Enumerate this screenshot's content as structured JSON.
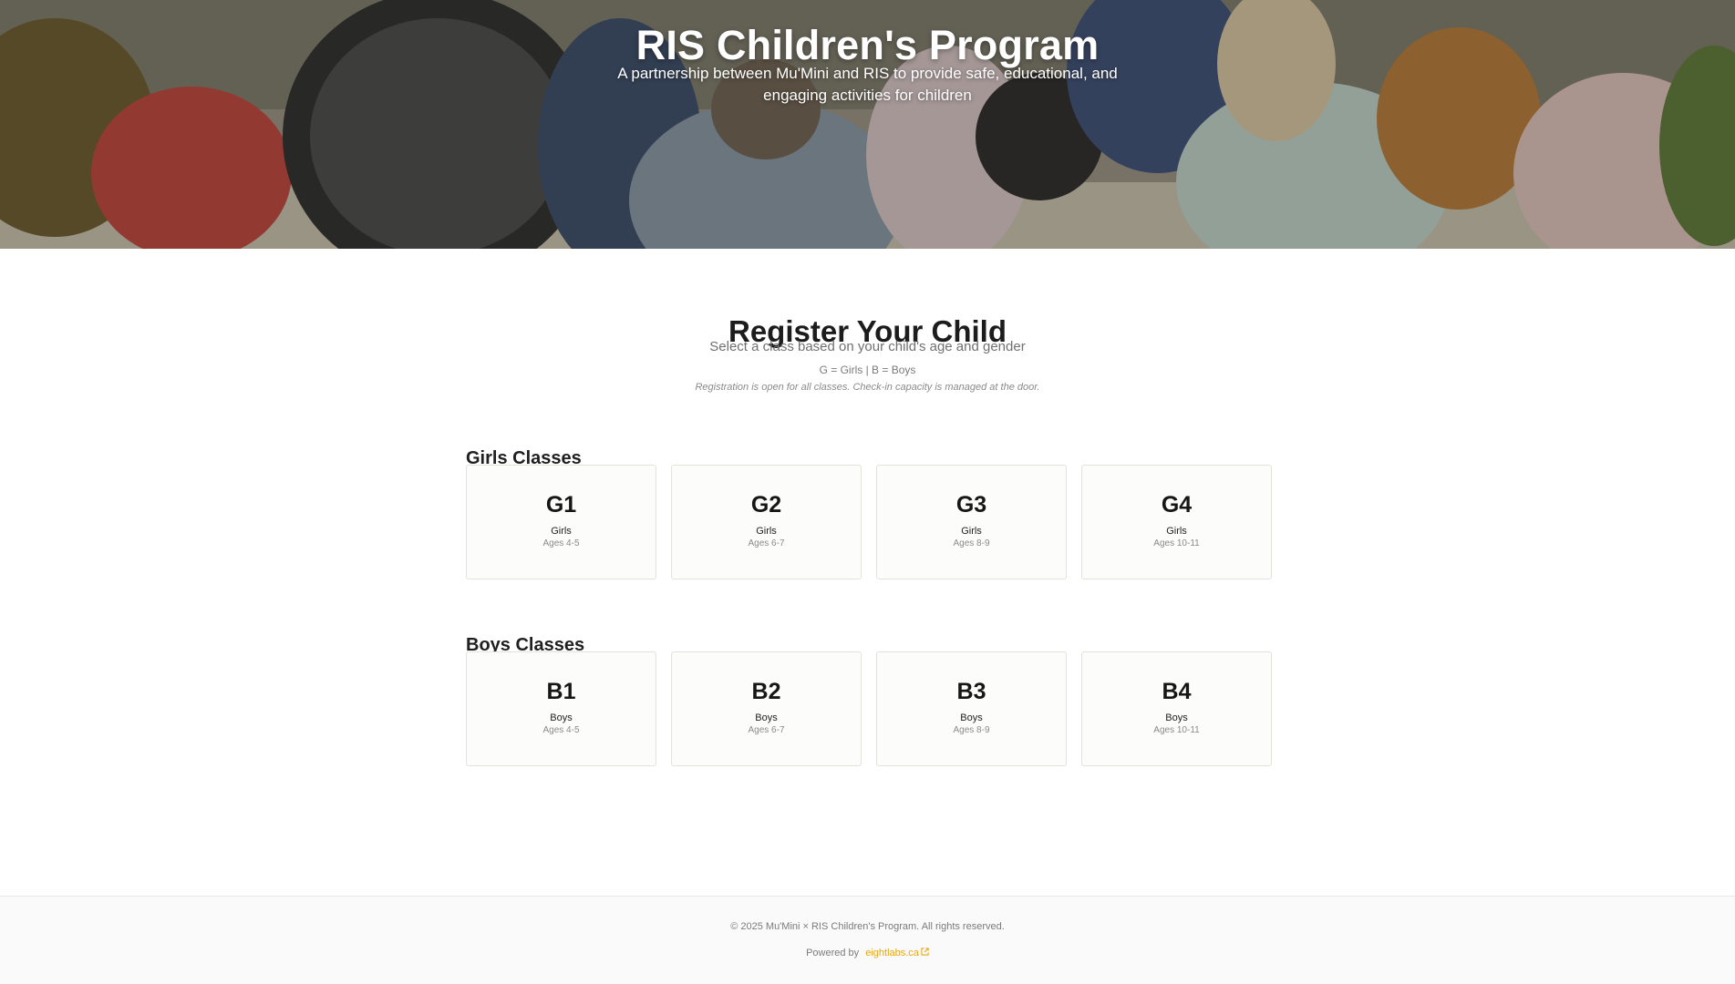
{
  "hero": {
    "title": "RIS Children's Program",
    "subtitle": "A partnership between Mu'Mini and RIS to provide safe, educational, and engaging activities for children"
  },
  "register": {
    "heading": "Register Your Child",
    "subheading": "Select a class based on your child's age and gender",
    "legend": "G = Girls | B = Boys",
    "note": "Registration is open for all classes. Check-in capacity is managed at the door."
  },
  "girls": {
    "heading": "Girls Classes",
    "classes": [
      {
        "code": "G1",
        "gender": "Girls",
        "ages": "Ages 4-5"
      },
      {
        "code": "G2",
        "gender": "Girls",
        "ages": "Ages 6-7"
      },
      {
        "code": "G3",
        "gender": "Girls",
        "ages": "Ages 8-9"
      },
      {
        "code": "G4",
        "gender": "Girls",
        "ages": "Ages 10-11"
      }
    ]
  },
  "boys": {
    "heading": "Boys Classes",
    "classes": [
      {
        "code": "B1",
        "gender": "Boys",
        "ages": "Ages 4-5"
      },
      {
        "code": "B2",
        "gender": "Boys",
        "ages": "Ages 6-7"
      },
      {
        "code": "B3",
        "gender": "Boys",
        "ages": "Ages 8-9"
      },
      {
        "code": "B4",
        "gender": "Boys",
        "ages": "Ages 10-11"
      }
    ]
  },
  "footer": {
    "copyright": "© 2025 Mu'Mini × RIS Children's Program. All rights reserved.",
    "powered_by": "Powered by",
    "link_text": "eightlabs.ca",
    "link_icon": "external-link-icon"
  },
  "colors": {
    "accent": "#e6a817",
    "card_border": "#e4e2dc",
    "card_bg": "#fcfcfa"
  }
}
